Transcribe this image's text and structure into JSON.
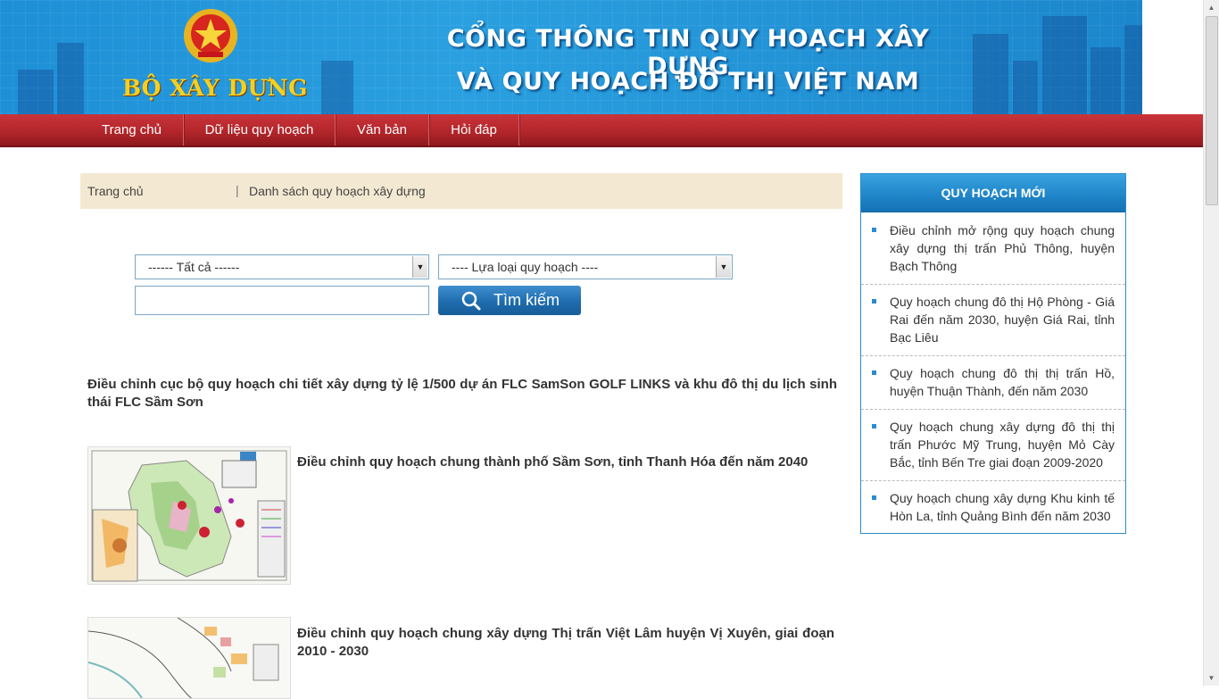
{
  "header": {
    "logo_text": "BỘ XÂY DỰNG",
    "title_line1": "CỔNG THÔNG TIN QUY HOẠCH XÂY DỰNG",
    "title_line2": "VÀ QUY HOẠCH ĐÔ THỊ VIỆT NAM"
  },
  "nav": {
    "items": [
      "Trang chủ",
      "Dữ liệu quy hoạch",
      "Văn bản",
      "Hỏi đáp"
    ]
  },
  "breadcrumb": {
    "home": "Trang chủ",
    "separator": "|",
    "current": "Danh sách quy hoạch xây dựng"
  },
  "search": {
    "select1_value": "------ Tất cả ------",
    "select2_value": "---- Lựa loại quy hoạch ----",
    "input_value": "",
    "button_label": "Tìm kiếm"
  },
  "articles": {
    "featured_title": "Điều chỉnh cục bộ quy hoạch chi tiết xây dựng tỷ lệ 1/500 dự án FLC SamSon GOLF LINKS và khu đô thị du lịch sinh thái FLC Sầm Sơn",
    "items": [
      {
        "title": "Điều chỉnh quy hoạch chung thành phố Sầm Sơn, tỉnh Thanh Hóa đến năm 2040"
      },
      {
        "title": "Điều chỉnh quy hoạch chung xây dựng Thị trấn Việt Lâm huyện Vị Xuyên, giai đoạn 2010 - 2030"
      }
    ]
  },
  "sidebar": {
    "title": "QUY HOẠCH MỚI",
    "items": [
      "Điều chỉnh mở rộng quy hoạch chung xây dựng thị trấn Phủ Thông, huyện Bạch Thông",
      "Quy hoạch chung đô thị Hộ Phòng - Giá Rai đến năm 2030, huyện Giá Rai, tỉnh Bạc Liêu",
      "Quy hoạch chung đô thị thị trấn Hồ, huyện Thuận Thành, đến năm 2030",
      "Quy hoạch chung xây dựng đô thị thị trấn Phước Mỹ Trung, huyện Mỏ Cày Bắc, tỉnh Bến Tre giai đoạn 2009-2020",
      "Quy hoạch chung xây dựng Khu kinh tế Hòn La, tỉnh Quảng Bình đến năm 2030"
    ]
  },
  "colors": {
    "nav_red": "#b3262b",
    "banner_blue": "#1e8fd6",
    "sidebar_blue": "#2a8ccd",
    "breadcrumb_bg": "#f3e9d2"
  }
}
